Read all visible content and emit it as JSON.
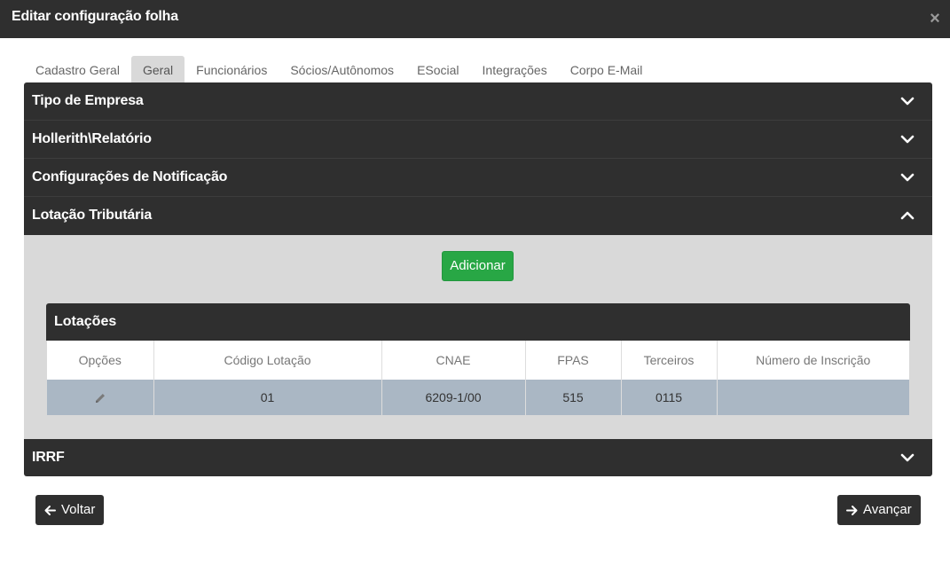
{
  "modal": {
    "title": "Editar configuração folha",
    "close_label": "×"
  },
  "tabs": [
    {
      "label": "Cadastro Geral"
    },
    {
      "label": "Geral",
      "active": true
    },
    {
      "label": "Funcionários"
    },
    {
      "label": "Sócios/Autônomos"
    },
    {
      "label": "ESocial"
    },
    {
      "label": "Integrações"
    },
    {
      "label": "Corpo E-Mail"
    }
  ],
  "sections": {
    "tipo_empresa": {
      "title": "Tipo de Empresa",
      "expanded": false
    },
    "hollerith": {
      "title": "Hollerith\\Relatório",
      "expanded": false
    },
    "notificacao": {
      "title": "Configurações de Notificação",
      "expanded": false
    },
    "lotacao": {
      "title": "Lotação Tributária",
      "expanded": true
    },
    "irrf": {
      "title": "IRRF",
      "expanded": false
    }
  },
  "lotacao": {
    "add_label": "Adicionar",
    "panel_title": "Lotações",
    "columns": [
      "Opções",
      "Código Lotação",
      "CNAE",
      "FPAS",
      "Terceiros",
      "Número de Inscrição"
    ],
    "rows": [
      {
        "codigo": "01",
        "cnae": "6209-1/00",
        "fpas": "515",
        "terceiros": "0115",
        "inscricao": ""
      }
    ]
  },
  "footer": {
    "back_label": "Voltar",
    "next_label": "Avançar"
  },
  "colors": {
    "dark": "#2f2f2f",
    "success": "#28a745",
    "row_bg": "#aab7c4",
    "body_bg": "#d9d9d9"
  }
}
